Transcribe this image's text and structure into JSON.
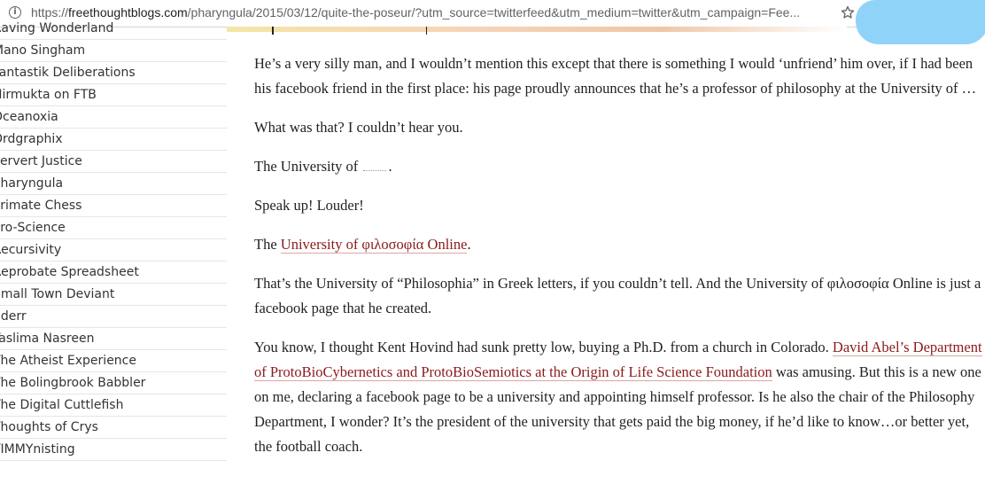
{
  "browser": {
    "url_prefix": "https://",
    "url_host": "freethoughtblogs.com",
    "url_rest": "/pharyngula/2015/03/12/quite-the-poseur/?utm_source=twitterfeed&utm_medium=twitter&utm_campaign=Fee..."
  },
  "sidebar": {
    "items": [
      "Raving Wonderland",
      "Mano Singham",
      "Fantastik Deliberations",
      "Nirmukta on FTB",
      "Oceanoxia",
      "Ordgraphix",
      "Pervert Justice",
      "Pharyngula",
      "Primate Chess",
      "Pro-Science",
      "Recursivity",
      "Reprobate Spreadsheet",
      "Small Town Deviant",
      "Sderr",
      "Taslima Nasreen",
      "The Atheist Experience",
      "The Bolingbrook Babbler",
      "The Digital Cuttlefish",
      "Thoughts of Crys",
      "TIMMYnisting"
    ]
  },
  "article": {
    "p1": "He’s a very silly man, and I wouldn’t mention this except that there is something I would ‘unfriend’ him over, if I had been his facebook friend in the first place: his page proudly announces that he’s a professor of philosophy at the University of …",
    "p2": "What was that? I couldn’t hear you.",
    "p3_before": "The University of ",
    "p3_after": ".",
    "p4": "Speak up! Louder!",
    "p5_before": "The ",
    "p5_link": "University of φιλοσοφία Online",
    "p5_after": ".",
    "p6": "That’s the University of “Philosophia” in Greek letters, if you couldn’t tell. And the University of φιλοσοφία Online is just a facebook page that he created.",
    "p7_before": "You know, I thought Kent Hovind had sunk pretty low, buying a Ph.D. from a church in Colorado. ",
    "p7_link": "David Abel’s Department of ProtoBioCybernetics and ProtoBioSemiotics at the Origin of Life Science Foundation",
    "p7_after": " was amusing. But this is a new one on me, declaring a facebook page to be a university and appointing himself professor. Is he also the chair of the Philosophy Department, I wonder? It’s the president of the university that gets paid the big money, if he’d like to know…or better yet, the football coach."
  },
  "colors": {
    "link": "#8b1a1a",
    "profile_blob": "#8fd3f9"
  },
  "icons": {
    "info": "info-icon",
    "star": "bookmark-star-icon"
  }
}
